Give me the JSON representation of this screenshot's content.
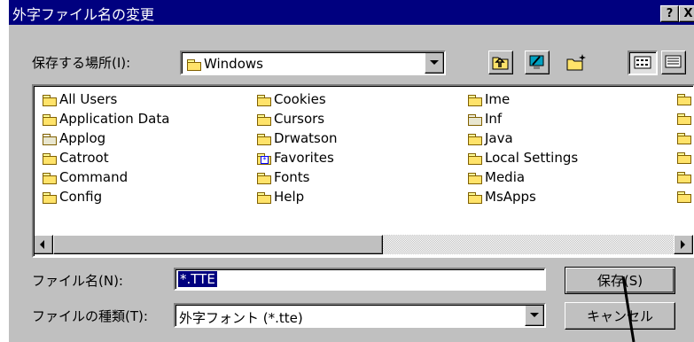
{
  "window": {
    "title": "外字ファイル名の変更"
  },
  "titlebar_buttons": {
    "help": "?",
    "close": "X"
  },
  "location": {
    "label": "保存する場所(I):",
    "value": "Windows"
  },
  "toolbar_icons": [
    "up-folder-icon",
    "desktop-icon",
    "new-folder-icon",
    "list-view-icon",
    "details-view-icon"
  ],
  "files": {
    "col1": [
      {
        "name": "All Users",
        "icon": "folder"
      },
      {
        "name": "Application Data",
        "icon": "folder"
      },
      {
        "name": "Applog",
        "icon": "folder-grey"
      },
      {
        "name": "Catroot",
        "icon": "folder"
      },
      {
        "name": "Command",
        "icon": "folder"
      },
      {
        "name": "Config",
        "icon": "folder"
      }
    ],
    "col2": [
      {
        "name": "Cookies",
        "icon": "folder"
      },
      {
        "name": "Cursors",
        "icon": "folder"
      },
      {
        "name": "Drwatson",
        "icon": "folder"
      },
      {
        "name": "Favorites",
        "icon": "favorites-folder"
      },
      {
        "name": "Fonts",
        "icon": "folder"
      },
      {
        "name": "Help",
        "icon": "folder"
      }
    ],
    "col3": [
      {
        "name": "Ime",
        "icon": "folder"
      },
      {
        "name": "Inf",
        "icon": "folder-grey"
      },
      {
        "name": "Java",
        "icon": "folder"
      },
      {
        "name": "Local Settings",
        "icon": "folder"
      },
      {
        "name": "Media",
        "icon": "folder"
      },
      {
        "name": "MsApps",
        "icon": "folder"
      }
    ]
  },
  "filename": {
    "label": "ファイル名(N):",
    "value": "*.TTE"
  },
  "filetype": {
    "label": "ファイルの種類(T):",
    "value": "外字フォント (*.tte)"
  },
  "buttons": {
    "save": "保存(S)",
    "cancel": "キャンセル"
  },
  "colors": {
    "titlebar": "#00007f",
    "face": "#c0c0c0",
    "selection": "#00007f"
  }
}
